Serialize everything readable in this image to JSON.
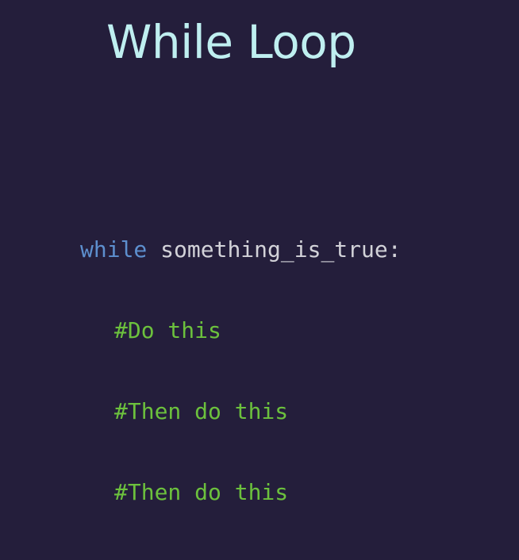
{
  "slide": {
    "title": "While Loop",
    "code": {
      "keyword": "while",
      "condition": " something_is_true:",
      "comments": [
        "#Do this",
        "#Then do this",
        "#Then do this"
      ]
    }
  },
  "colors": {
    "background": "#241e3b",
    "title": "#bfeff0",
    "keyword": "#5d8fce",
    "text": "#d2d2d8",
    "comment": "#6cc13d"
  }
}
